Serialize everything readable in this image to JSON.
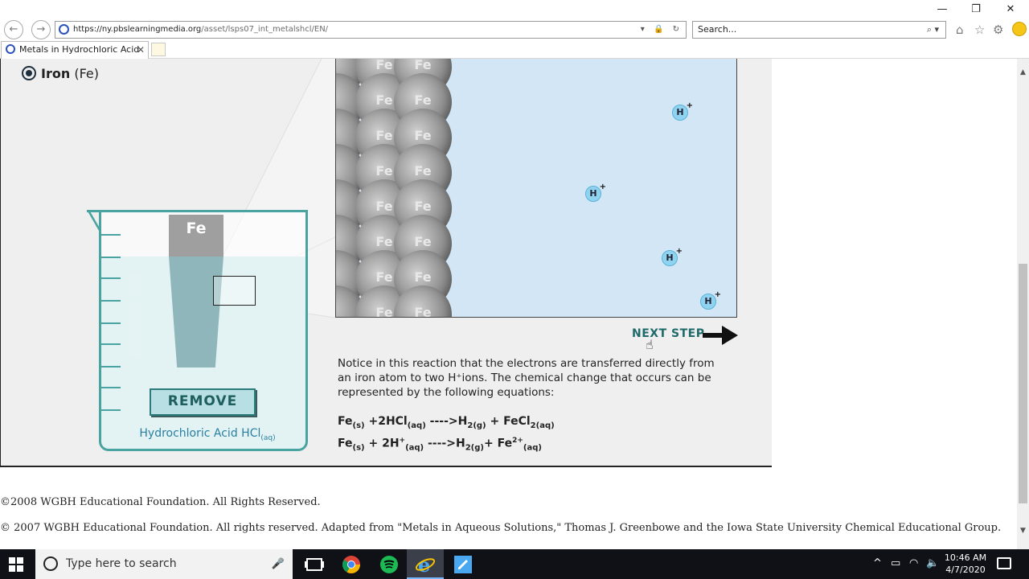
{
  "browser": {
    "url_host": "https://ny.pbslearningmedia.org",
    "url_path": "/asset/lsps07_int_metalshcl/EN/",
    "search_placeholder": "Search...",
    "tab_title": "Metals in Hydrochloric Acid",
    "back_glyph": "←",
    "forward_glyph": "→",
    "minimize_glyph": "—",
    "restore_glyph": "❐",
    "close_glyph": "✕",
    "tab_close_glyph": "✕",
    "address_icons": "▾ 🔒 ↻",
    "search_icon": "⌕ ▾",
    "home_icon": "⌂",
    "favorites_icon": "☆",
    "settings_icon": "⚙"
  },
  "page": {
    "selected_metal": "Iron",
    "selected_metal_symbol": "(Fe)",
    "rod_label": "Fe",
    "remove_label": "REMOVE",
    "acid_label": "Hydrochloric Acid HCl",
    "acid_sub": "(aq)",
    "atom_label": "Fe",
    "h_label": "H",
    "h_charge": "+",
    "next_step": "NEXT STEP",
    "notice": "Notice in this reaction that the electrons are transferred directly from an iron atom to two H⁺ions. The chemical change that occurs can be represented by the following equations:",
    "eq1": {
      "a": "Fe",
      "a_sub": "(s)",
      "b": " +2HCl",
      "b_sub": "(aq)",
      "arrow": " ---->H",
      "c_sub": "2(g)",
      "d": " + FeCl",
      "d_sub": "2(aq)"
    },
    "eq2": {
      "a": "Fe",
      "a_sub": "(s)",
      "b": " + 2H",
      "b_sup": "+",
      "b_sub": "(aq)",
      "arrow": " ---->H",
      "c_sub": "2(g)",
      "d": "+ Fe",
      "d_sup": "2+",
      "d_sub": "(aq)"
    }
  },
  "footer": {
    "line1": "©2008 WGBH Educational Foundation. All Rights Reserved.",
    "line2": "© 2007 WGBH Educational Foundation. All rights reserved. Adapted from \"Metals in Aqueous Solutions,\" Thomas J. Greenbowe and the Iowa State University Chemical Educational Group."
  },
  "taskbar": {
    "search_placeholder": "Type here to search",
    "time": "10:46 AM",
    "date": "4/7/2020"
  },
  "colors": {
    "teal": "#49a3a1",
    "panel_bg": "#d3e6f6",
    "h_ion": "#8fd3f0"
  }
}
